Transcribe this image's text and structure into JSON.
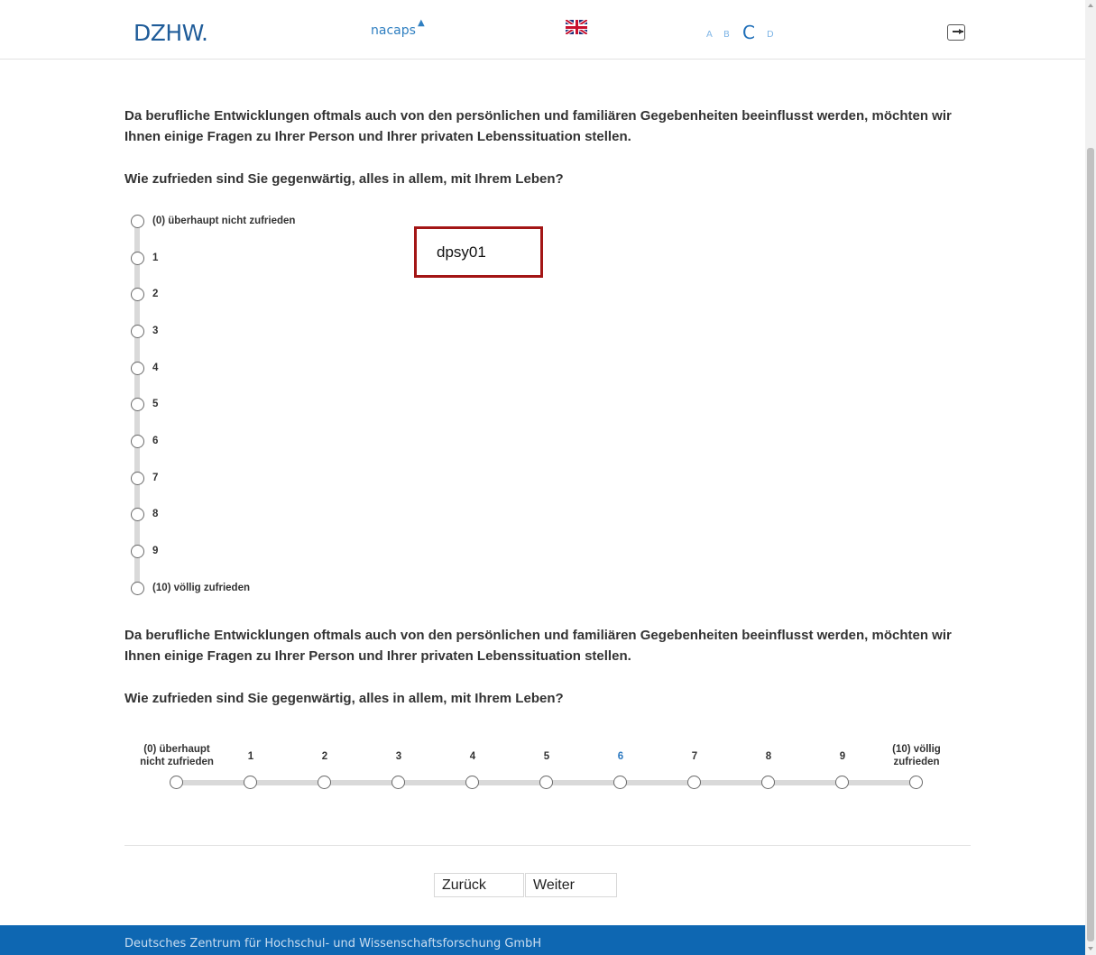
{
  "header": {
    "logo_dzhw": "DZHW.",
    "logo_nacaps": "nacaps",
    "font_size_options": [
      "A",
      "B",
      "C",
      "D"
    ],
    "active_font_size": "C"
  },
  "question1": {
    "intro": "Da berufliche Entwicklungen oftmals auch von den persönlichen und familiären Gegebenheiten beeinflusst werden, möchten wir Ihnen einige Fragen zu Ihrer Person und Ihrer privaten Lebenssituation stellen.",
    "question": "Wie zufrieden sind Sie gegenwärtig, alles in allem, mit Ihrem Leben?",
    "options": [
      "(0) überhaupt nicht zufrieden",
      "1",
      "2",
      "3",
      "4",
      "5",
      "6",
      "7",
      "8",
      "9",
      "(10) völlig zufrieden"
    ],
    "selected": null
  },
  "variable_label": "dpsy01",
  "question2": {
    "intro": "Da berufliche Entwicklungen oftmals auch von den persönlichen und familiären Gegebenheiten beeinflusst werden, möchten wir Ihnen einige Fragen zu Ihrer Person und Ihrer privaten Lebenssituation stellen.",
    "question": "Wie zufrieden sind Sie gegenwärtig, alles in allem, mit Ihrem Leben?",
    "options": [
      {
        "line1": "(0) überhaupt",
        "line2": "nicht zufrieden"
      },
      {
        "line1": "1"
      },
      {
        "line1": "2"
      },
      {
        "line1": "3"
      },
      {
        "line1": "4"
      },
      {
        "line1": "5"
      },
      {
        "line1": "6"
      },
      {
        "line1": "7"
      },
      {
        "line1": "8"
      },
      {
        "line1": "9"
      },
      {
        "line1": "(10) völlig",
        "line2": "zufrieden"
      }
    ],
    "highlighted": "6",
    "selected": null
  },
  "nav": {
    "back_label": "Zurück",
    "next_label": "Weiter"
  },
  "footer": {
    "text": "Deutsches Zentrum für Hochschul- und Wissenschaftsforschung GmbH"
  },
  "colors": {
    "brand_blue": "#0e67b2",
    "variable_box_border": "#a31515"
  }
}
